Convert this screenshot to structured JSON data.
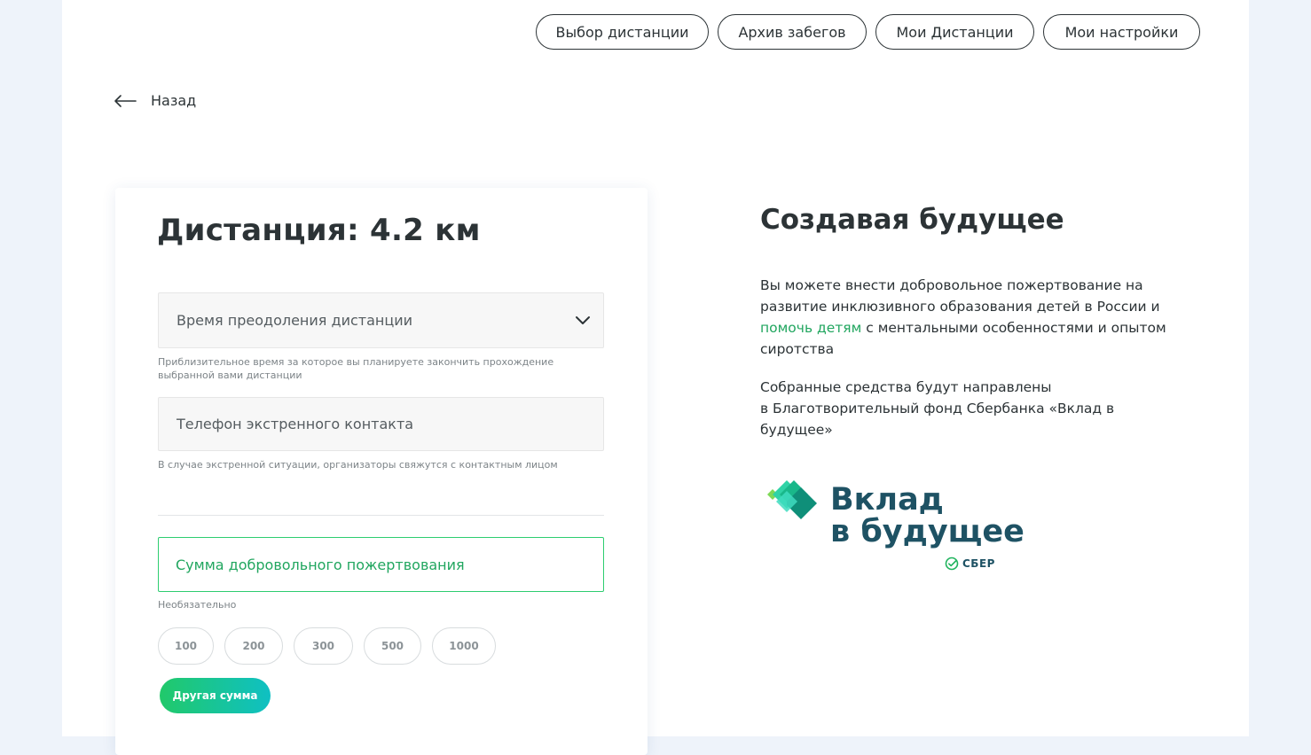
{
  "nav": [
    {
      "label": "Выбор дистанции"
    },
    {
      "label": "Архив забегов"
    },
    {
      "label": "Мои Дистанции"
    },
    {
      "label": "Мои настройки"
    }
  ],
  "back": {
    "label": "Назад",
    "icon": "arrow-left-icon"
  },
  "form": {
    "title": "Дистанция: 4.2 км",
    "time_select": {
      "placeholder": "Время преодоления дистанции",
      "hint": "Приблизительное время за которое вы планируете закончить прохождение выбранной вами дистанции"
    },
    "phone_field": {
      "placeholder": "Телефон экстренного контакта",
      "hint": "В случае экстренной ситуации, организаторы свяжутся с контактным лицом"
    },
    "donation_field": {
      "placeholder": "Сумма добровольного пожертвования",
      "hint": "Необязательно"
    },
    "amounts": [
      "100",
      "200",
      "300",
      "500",
      "1000"
    ],
    "other_amount_label": "Другая сумма"
  },
  "info": {
    "title": "Создавая будущее",
    "p1_before": "Вы можете внести добровольное пожертвование на развитие инклюзивного образования детей в России и ",
    "p1_link": "помочь детям",
    "p1_after": " с ментальными особенностями и опытом сиротства",
    "p2_line1": "Собранные средства будут направлены",
    "p2_line2": "в Благотворительный фонд Сбербанка «Вклад в будущее»"
  },
  "logo": {
    "line1": "Вклад",
    "line2": "в будущее",
    "sub": "СБЕР"
  },
  "colors": {
    "accent_green": "#21a65f",
    "brand_teal": "#1e5264",
    "button_gradient_start": "#21c96a",
    "button_gradient_end": "#0fc0c3"
  }
}
